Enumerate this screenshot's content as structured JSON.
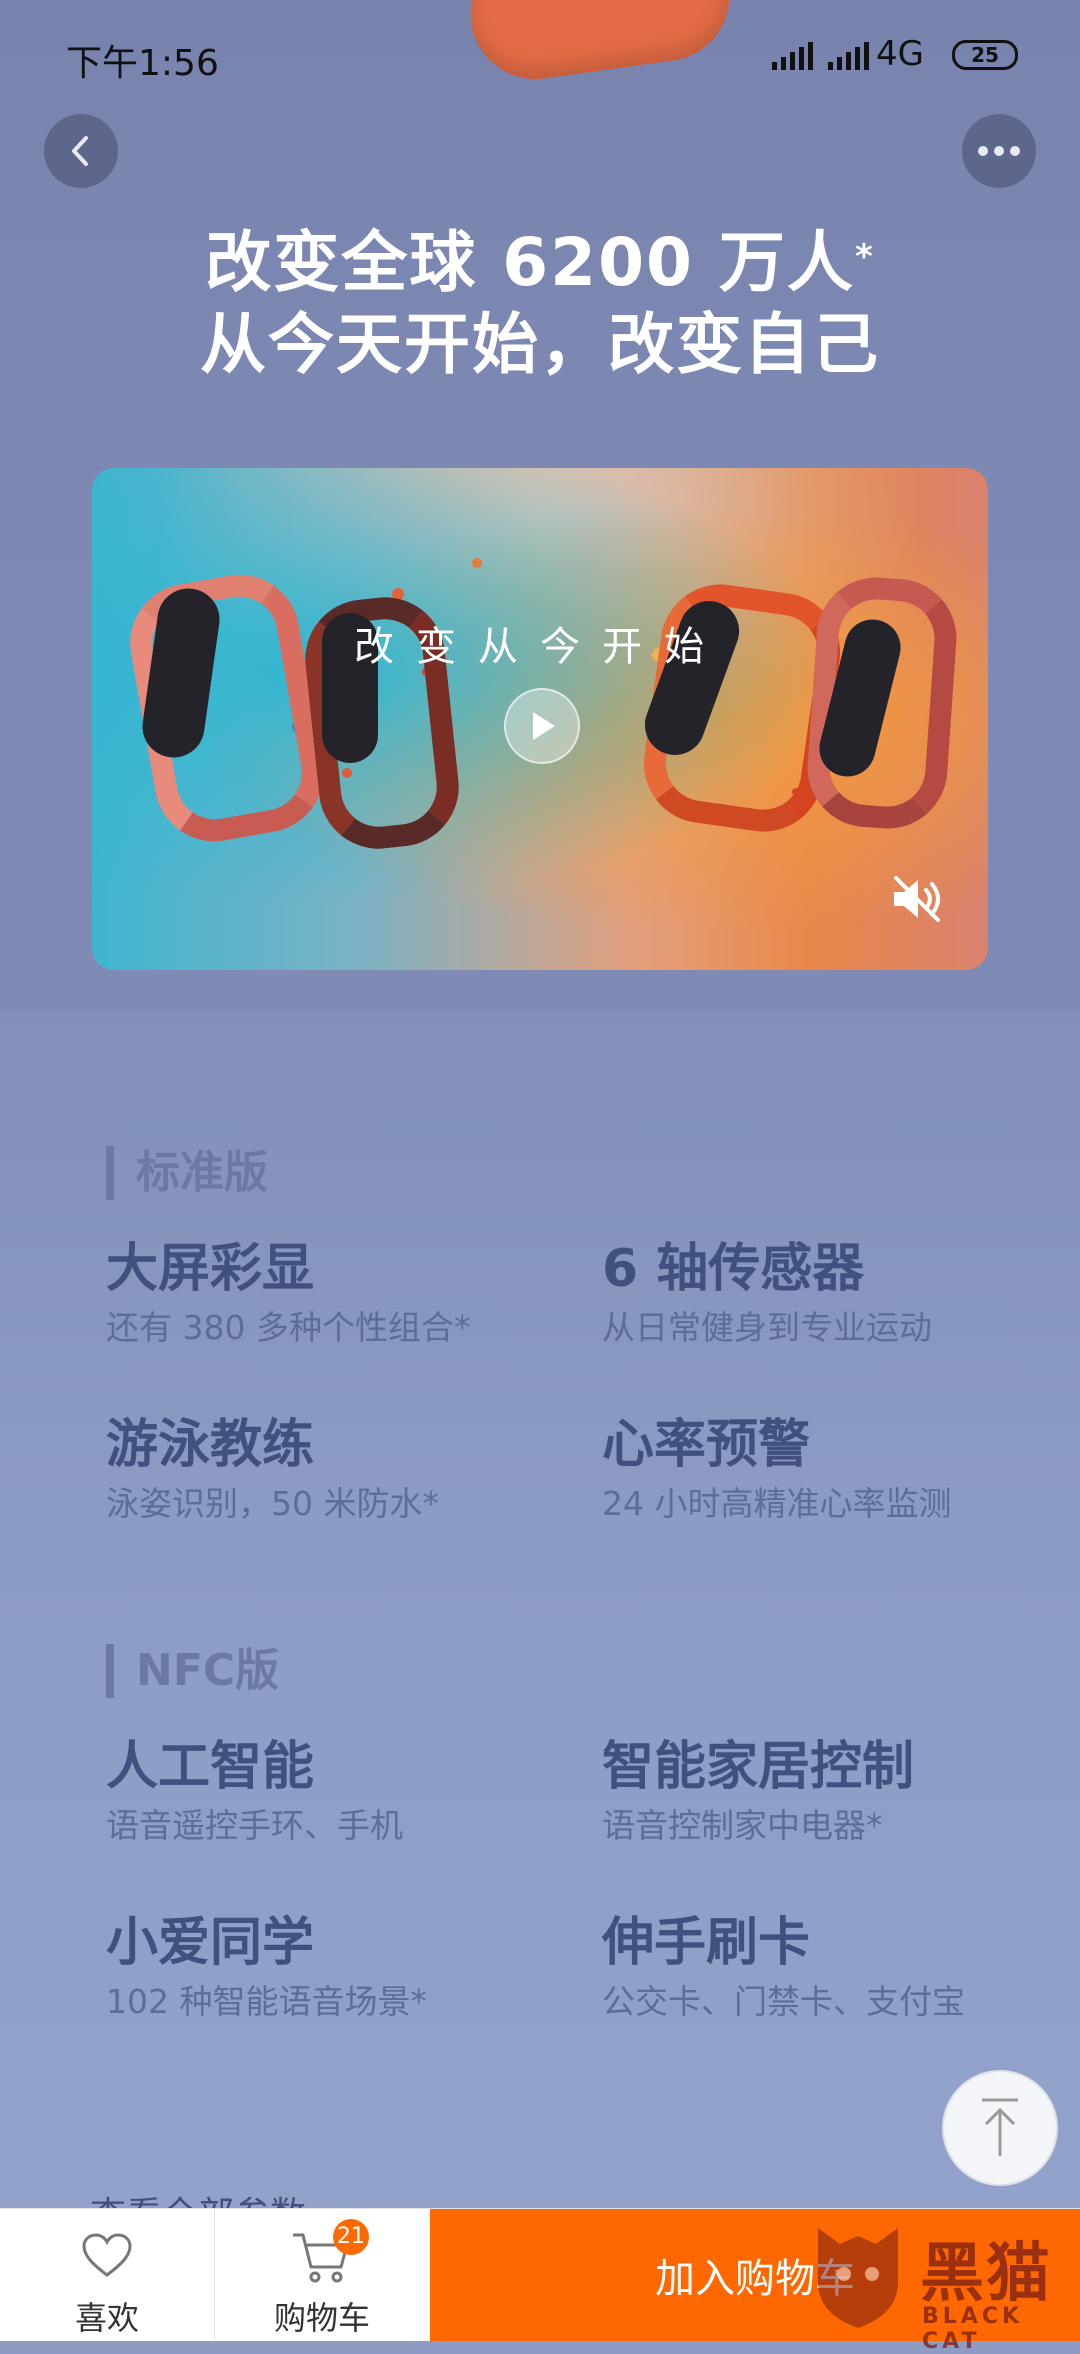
{
  "status_bar": {
    "time": "下午1:56",
    "network": "4G",
    "battery": "25"
  },
  "hero": {
    "line1": "改变全球 6200 万人",
    "line1_mark": "*",
    "line2": "从今天开始，改变自己"
  },
  "video": {
    "caption": "改变从今开始",
    "play_icon": "play-icon",
    "mute_icon": "speaker-mute-icon"
  },
  "sections": [
    {
      "title": "标准版",
      "features": [
        {
          "title": "大屏彩显",
          "desc": "还有 380 多种个性组合*"
        },
        {
          "title": "6 轴传感器",
          "desc": "从日常健身到专业运动"
        },
        {
          "title": "游泳教练",
          "desc": "泳姿识别，50 米防水*"
        },
        {
          "title": "心率预警",
          "desc": "24 小时高精准心率监测"
        }
      ]
    },
    {
      "title": "NFC版",
      "features": [
        {
          "title": "人工智能",
          "desc": "语音遥控手环、手机"
        },
        {
          "title": "智能家居控制",
          "desc": "语音控制家中电器*"
        },
        {
          "title": "小爱同学",
          "desc": "102 种智能语音场景*"
        },
        {
          "title": "伸手刷卡",
          "desc": "公交卡、门禁卡、支付宝"
        }
      ]
    }
  ],
  "more_link": "查看全部参数 ›",
  "bottom_bar": {
    "like_label": "喜欢",
    "cart_label": "购物车",
    "cart_count": "21",
    "add_to_cart": "加入购物车"
  },
  "watermark": {
    "text": "黑猫",
    "sub": "BLACK CAT"
  },
  "colors": {
    "accent": "#ff6700",
    "background": "#8e9cc3",
    "feature_title": "#42507f"
  }
}
